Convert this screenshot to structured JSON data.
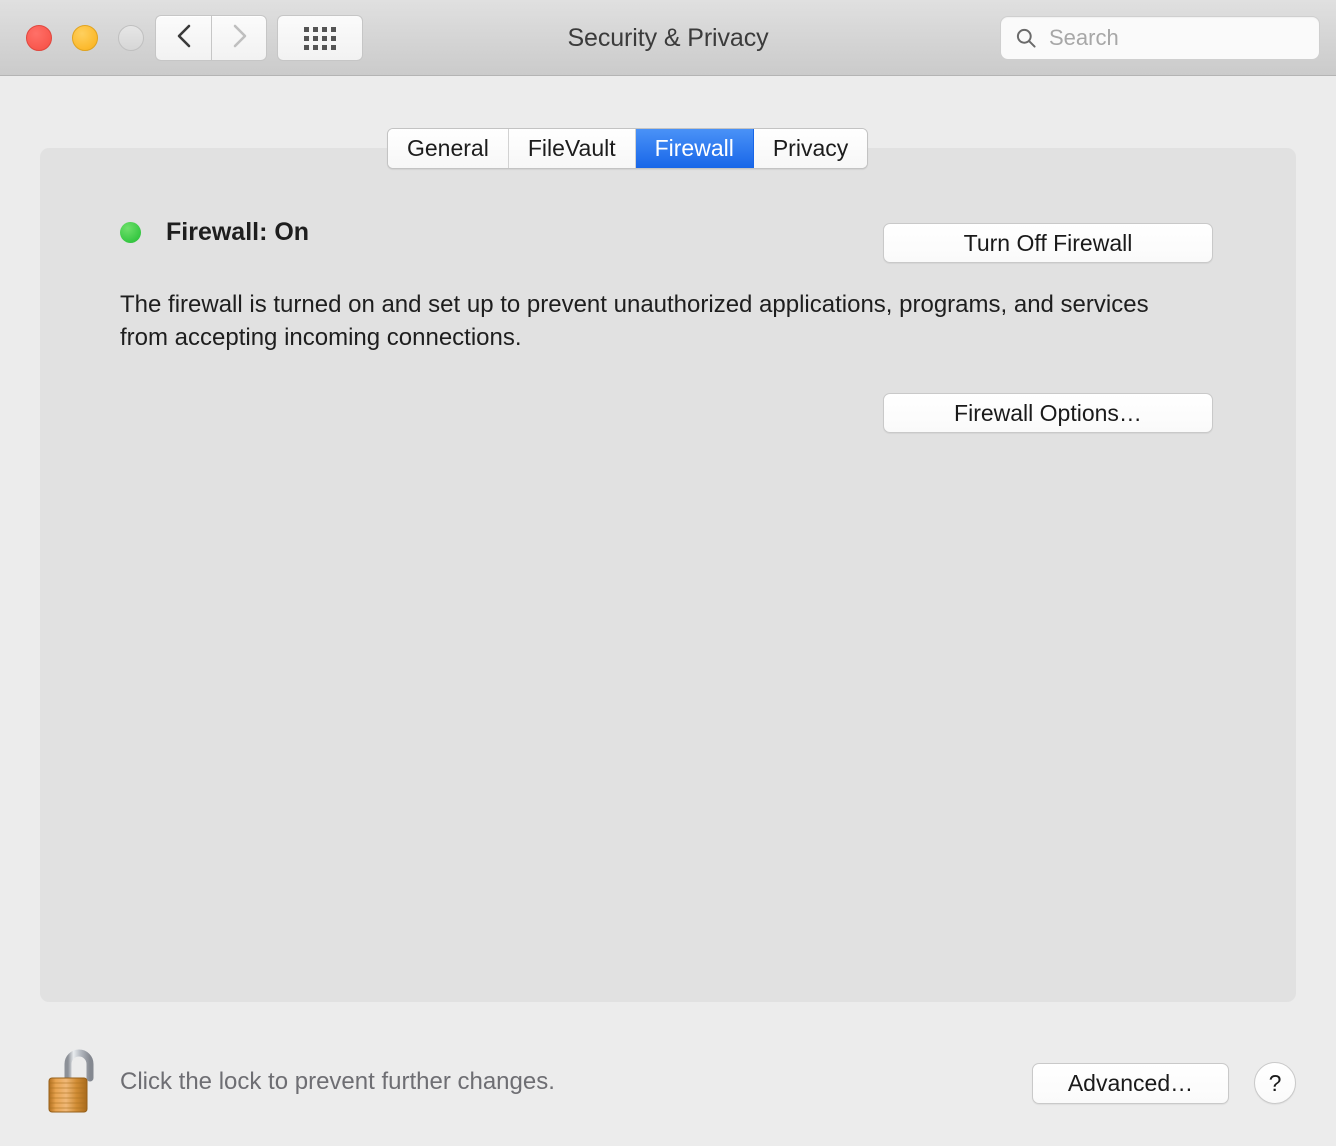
{
  "window": {
    "title": "Security & Privacy",
    "traffic_lights": [
      {
        "name": "close",
        "color": "#F8564C"
      },
      {
        "name": "minimize",
        "color": "#FBB82A"
      },
      {
        "name": "zoom",
        "color": "#DCDCDC"
      }
    ],
    "nav": {
      "back_label": "‹",
      "forward_label": "›",
      "grid_label": "Show All"
    }
  },
  "search": {
    "placeholder": "Search",
    "value": "",
    "icon": "search-icon"
  },
  "tabs": [
    {
      "label": "General",
      "selected": false
    },
    {
      "label": "FileVault",
      "selected": false
    },
    {
      "label": "Firewall",
      "selected": true
    },
    {
      "label": "Privacy",
      "selected": false
    }
  ],
  "firewall": {
    "status_label": "Firewall: On",
    "status_state": "On",
    "status_color": "#36C742",
    "description": "The firewall is turned on and set up to prevent unauthorized applications, programs, and services from accepting incoming connections.",
    "toggle_button_label": "Turn Off Firewall",
    "options_button_label": "Firewall Options…"
  },
  "footer": {
    "lock_icon": "unlocked-padlock-icon",
    "lock_state": "unlocked",
    "lock_hint": "Click the lock to prevent further changes.",
    "advanced_label": "Advanced…",
    "help_label": "?"
  },
  "colors": {
    "window_bg": "#ECECEC",
    "panel_bg": "#E1E1E1",
    "titlebar_bg": "#D4D4D4",
    "accent_blue": "#1866E8",
    "status_green": "#36C742",
    "muted_text": "#6E6E73"
  }
}
